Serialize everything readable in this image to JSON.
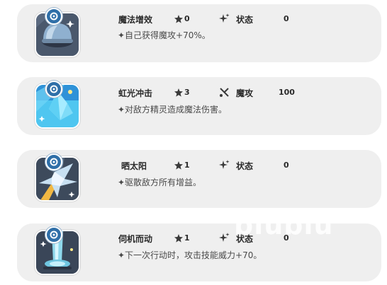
{
  "skills": [
    {
      "name": "魔法增效",
      "star_level": "0",
      "stat_label": "状态",
      "stat_value": "0",
      "stat_icon": "sparkle-icon",
      "description": "✦自己获得魔攻+70%。",
      "art": "dome-art"
    },
    {
      "name": "虹光冲击",
      "star_level": "3",
      "stat_label": "魔攻",
      "stat_value": "100",
      "stat_icon": "magic-attack-icon",
      "description": "✦对敌方精灵造成魔法伤害。",
      "art": "crystal-art"
    },
    {
      "name": "晒太阳",
      "star_level": "1",
      "stat_label": "状态",
      "stat_value": "0",
      "stat_icon": "sparkle-icon",
      "description": "✦驱散敌方所有增益。",
      "art": "sunbeam-art"
    },
    {
      "name": "伺机而动",
      "star_level": "1",
      "stat_label": "状态",
      "stat_value": "0",
      "stat_icon": "sparkle-icon",
      "description": "✦下一次行动时，攻击技能威力+70。",
      "art": "spotlight-art"
    }
  ],
  "watermark": "biubiu",
  "colors": {
    "card_bg": "#efefef",
    "badge": "#2f6fa8",
    "icon_dark": "#3d4a5c",
    "icon_cyan": "#41c8f0"
  }
}
